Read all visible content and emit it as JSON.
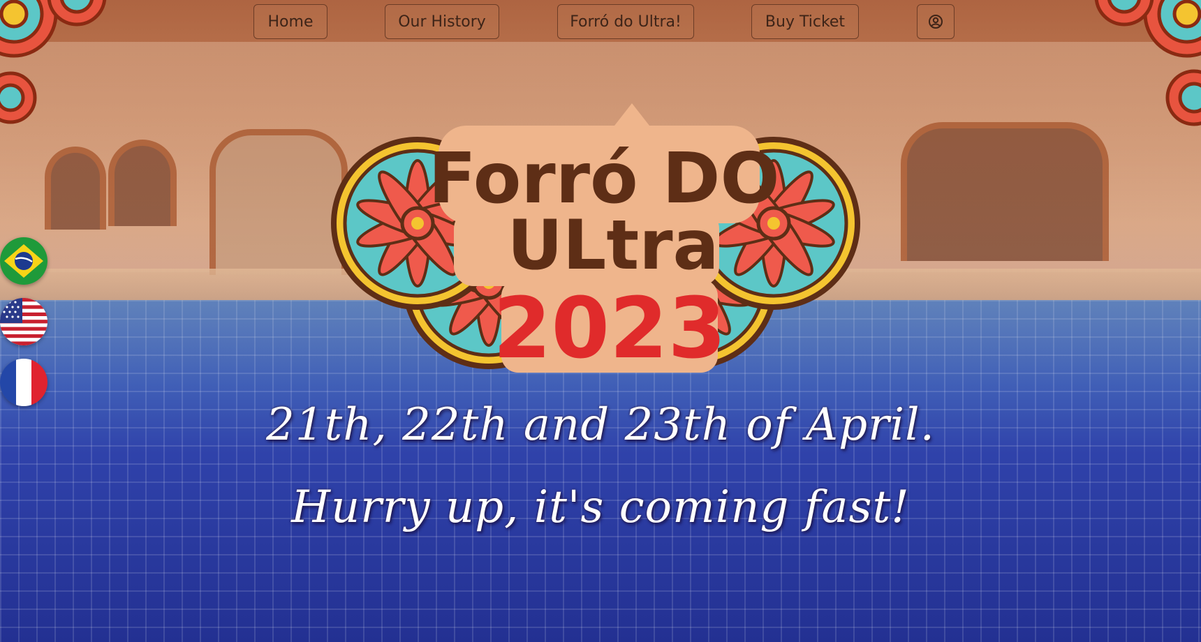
{
  "nav": {
    "home": "Home",
    "history": "Our History",
    "forro": "Forró do Ultra!",
    "ticket": "Buy Ticket",
    "account_icon": "user-circle-icon"
  },
  "languages": [
    {
      "name": "flag-brazil",
      "code": "pt"
    },
    {
      "name": "flag-usa",
      "code": "en"
    },
    {
      "name": "flag-france",
      "code": "fr"
    }
  ],
  "logo": {
    "line1": "Forró DO",
    "line2": "ULtra",
    "year": "2023"
  },
  "tagline": {
    "line1": "21th, 22th and 23th of April.",
    "line2": "Hurry up, it's coming fast!"
  },
  "colors": {
    "logo_brown": "#5e2e16",
    "logo_red": "#e02b2b",
    "tile_cream": "#efb58c",
    "mandala_teal": "#5cc7c7",
    "mandala_coral": "#ef5a4c",
    "mandala_gold": "#f4c430"
  }
}
